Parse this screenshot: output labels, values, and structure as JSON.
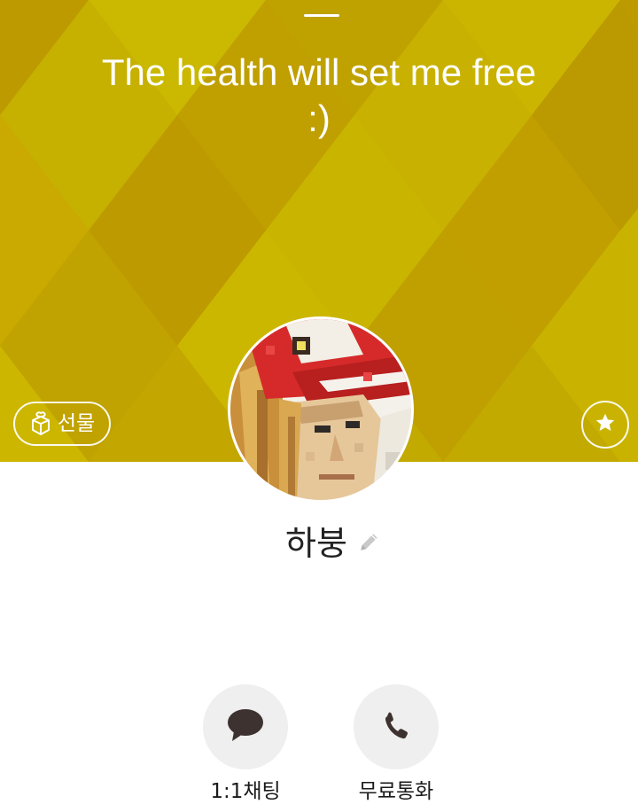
{
  "profile": {
    "status_message": "The health will set me free :)",
    "name": "하붕",
    "avatar_icon": "pixel-art-portrait-red-cap"
  },
  "header": {
    "background_color": "#c3ac00",
    "accent_light": "#cbb800",
    "accent_dark": "#bc9a00"
  },
  "gift_button": {
    "label": "선물",
    "icon": "gift-box-icon"
  },
  "favorite_button": {
    "icon": "star-icon"
  },
  "edit_name": {
    "icon": "pencil-icon"
  },
  "actions": [
    {
      "label": "1:1채팅",
      "icon": "speech-bubble-icon"
    },
    {
      "label": "무료통화",
      "icon": "phone-icon"
    }
  ]
}
